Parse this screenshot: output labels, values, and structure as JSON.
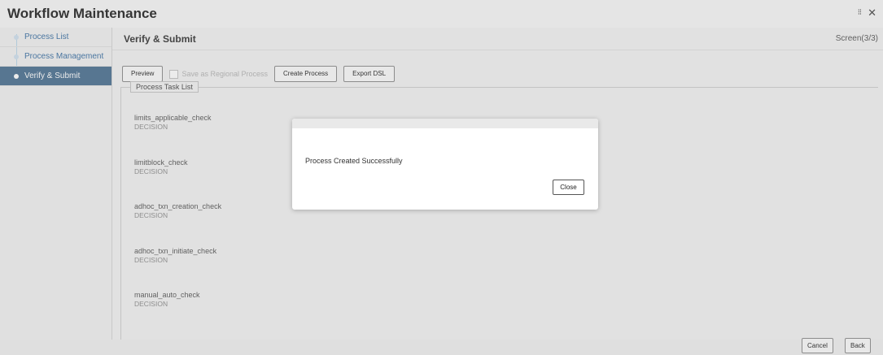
{
  "window": {
    "title": "Workflow Maintenance",
    "controls": [
      {
        "icon": "resize-icon",
        "glyph": "⁝⁝"
      },
      {
        "icon": "close-icon",
        "glyph": "✕"
      }
    ]
  },
  "sidebar": {
    "items": [
      {
        "label": "Process List",
        "active": false
      },
      {
        "label": "Process Management",
        "active": false
      },
      {
        "label": "Verify & Submit",
        "active": true
      }
    ]
  },
  "main": {
    "title": "Verify & Submit",
    "screen_indicator": "Screen(3/3)",
    "toolbar": {
      "preview_label": "Preview",
      "regional_checkbox_label": "Save as Regional Process",
      "regional_checked": false,
      "create_label": "Create Process",
      "export_label": "Export DSL"
    },
    "task_list": {
      "legend": "Process Task List",
      "tasks": [
        {
          "name": "limits_applicable_check",
          "type": "DECISION"
        },
        {
          "name": "limitblock_check",
          "type": "DECISION"
        },
        {
          "name": "adhoc_txn_creation_check",
          "type": "DECISION"
        },
        {
          "name": "adhoc_txn_initiate_check",
          "type": "DECISION"
        },
        {
          "name": "manual_auto_check",
          "type": "DECISION"
        }
      ]
    }
  },
  "footer": {
    "cancel_label": "Cancel",
    "back_label": "Back"
  },
  "modal": {
    "message": "Process Created Successfully",
    "close_label": "Close"
  }
}
